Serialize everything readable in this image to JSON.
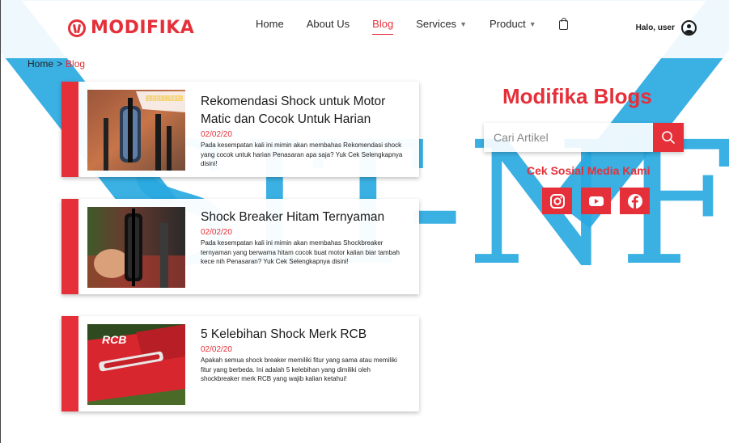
{
  "header": {
    "brand": "MODIFIKA",
    "nav": [
      {
        "label": "Home"
      },
      {
        "label": "About Us"
      },
      {
        "label": "Blog"
      },
      {
        "label": "Services"
      },
      {
        "label": "Product"
      }
    ],
    "user_greeting": "Halo, user"
  },
  "breadcrumb": {
    "home": "Home",
    "separator": ">",
    "current": "Blog"
  },
  "posts": [
    {
      "title": "Rekomendasi Shock untuk Motor Matic dan Cocok Untuk Harian",
      "date": "02/02/20",
      "excerpt": "Pada kesempatan kali ini mimin akan membahas Rekomendasi shock yang cocok untuk harian Penasaran apa saja? Yuk Cek Selengkapnya disini!",
      "image_label": "NEW ITEMS! SHOCK RP 240 320MM UNIVERSAL MATIC SINGLE SHOCK"
    },
    {
      "title": "Shock Breaker Hitam Ternyaman",
      "date": "02/02/20",
      "excerpt": "Pada kesempatan kali ini mimin akan membahas Shockbreaker ternyaman yang berwarna hitam cocok buat motor kalian biar tambah kece nih Penasaran? Yuk Cek Selengkapnya disini!"
    },
    {
      "title": "5 Kelebihan Shock Merk RCB",
      "date": "02/02/20",
      "excerpt": "Apakah semua shock breaker memiliki fitur yang sama atau memiliki fitur yang berbeda. Ini adalah 5 kelebihan yang dimiliki oleh shockbreaker merk RCB yang wajib kalian ketahui!",
      "image_label": "RCB"
    }
  ],
  "sidebar": {
    "title": "Modifika Blogs",
    "search_placeholder": "Cari Artikel",
    "social_label": "Cek Sosial Media Kami"
  },
  "watermark": "SIT-NF",
  "colors": {
    "accent": "#e5303a",
    "watermark": "#29a9e1"
  }
}
